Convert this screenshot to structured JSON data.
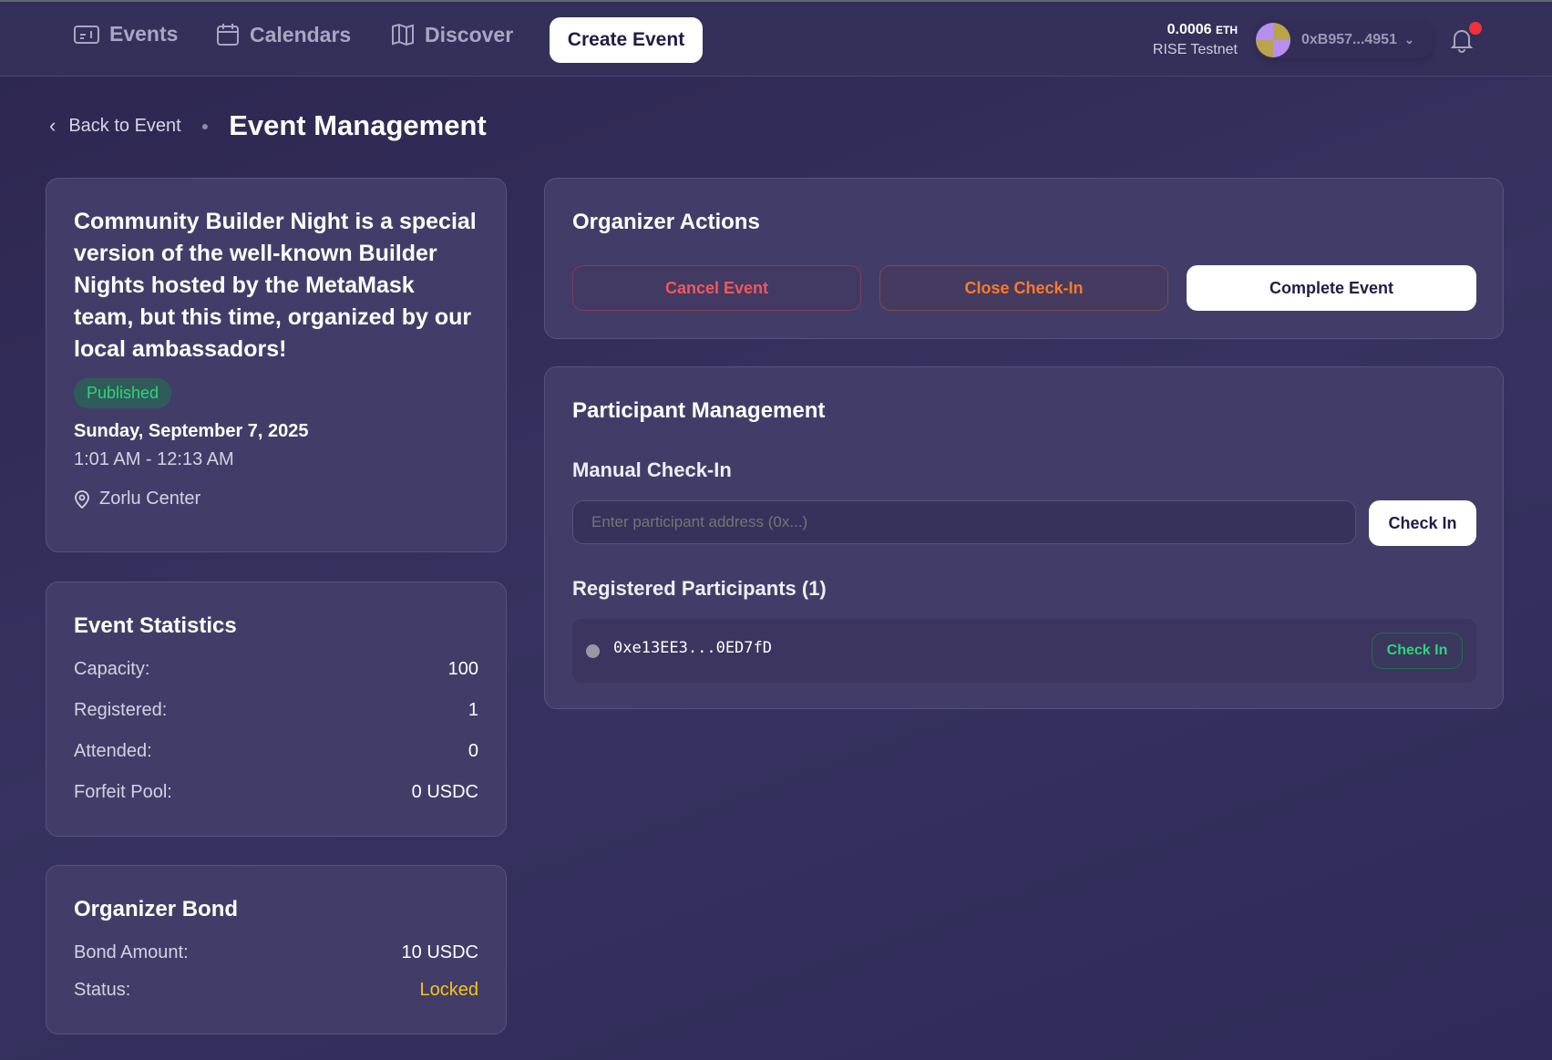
{
  "nav": {
    "items": [
      {
        "label": "Events",
        "icon": "ticket-icon"
      },
      {
        "label": "Calendars",
        "icon": "calendar-icon"
      },
      {
        "label": "Discover",
        "icon": "map-icon"
      }
    ],
    "create_label": "Create Event"
  },
  "wallet": {
    "balance": "0.0006",
    "unit": "ETH",
    "network": "RISE Testnet",
    "address": "0xB957...4951"
  },
  "breadcrumb": {
    "back": "Back to Event",
    "title": "Event Management"
  },
  "event": {
    "title": "Community Builder Night is a special version of the well-known Builder Nights hosted by the MetaMask team, but this time, organized by our local ambassadors!",
    "status": "Published",
    "date": "Sunday, September 7, 2025",
    "time": "1:01 AM - 12:13 AM",
    "location": "Zorlu Center"
  },
  "stats": {
    "title": "Event Statistics",
    "rows": [
      {
        "label": "Capacity:",
        "value": "100"
      },
      {
        "label": "Registered:",
        "value": "1"
      },
      {
        "label": "Attended:",
        "value": "0"
      },
      {
        "label": "Forfeit Pool:",
        "value": "0 USDC"
      }
    ]
  },
  "bond": {
    "title": "Organizer Bond",
    "amount_label": "Bond Amount:",
    "amount": "10 USDC",
    "status_label": "Status:",
    "status": "Locked"
  },
  "actions": {
    "title": "Organizer Actions",
    "cancel": "Cancel Event",
    "close": "Close Check-In",
    "complete": "Complete Event"
  },
  "participants": {
    "title": "Participant Management",
    "manual_title": "Manual Check-In",
    "placeholder": "Enter participant address (0x...)",
    "check_in": "Check In",
    "registered_title": "Registered Participants (1)",
    "list": [
      {
        "address": "0xe13EE3...0ED7fD",
        "action": "Check In"
      }
    ]
  },
  "colors": {
    "published": "#2ed47a",
    "locked": "#f5c518",
    "cancel": "#f0575f",
    "close": "#f97a2c"
  }
}
